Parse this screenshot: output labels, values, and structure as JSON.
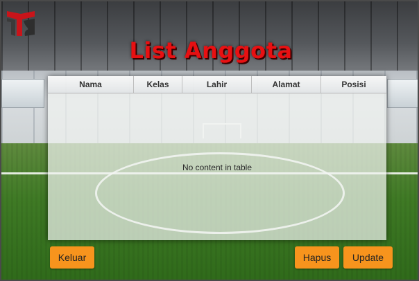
{
  "page": {
    "title": "List Anggota"
  },
  "table": {
    "columns": [
      "Nama",
      "Kelas",
      "Lahir",
      "Alamat",
      "Posisi"
    ],
    "empty_message": "No content in table"
  },
  "buttons": {
    "keluar": "Keluar",
    "hapus": "Hapus",
    "update": "Update"
  },
  "colors": {
    "title": "#e81012",
    "button": "#f7941d"
  },
  "icons": {
    "logo": "app-logo-icon"
  }
}
